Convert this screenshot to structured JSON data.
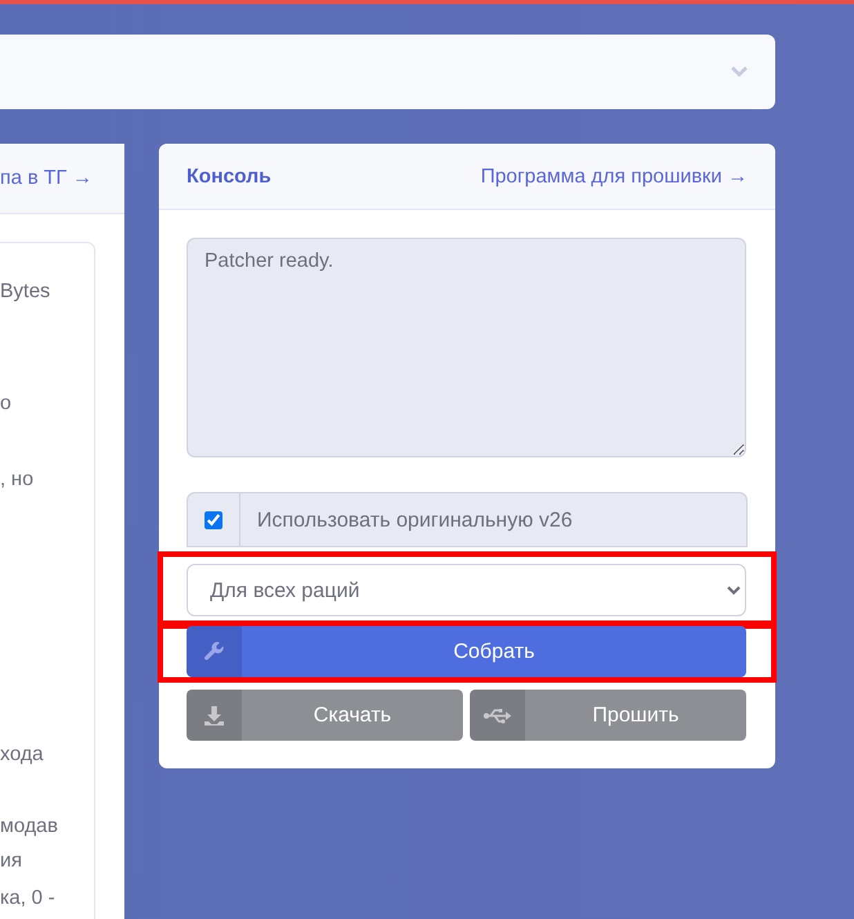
{
  "left_panel": {
    "header_link": "па в ТГ →",
    "lines": [
      "Bytes",
      "о",
      ", но",
      "хода",
      "модав",
      "ия",
      "ка, 0 -"
    ]
  },
  "console_panel": {
    "title": "Консоль",
    "header_link": "Программа для прошивки →",
    "log": "Patcher ready.",
    "use_original": {
      "label": "Использовать оригинальную v26",
      "checked": true
    },
    "radio_select": {
      "value": "Для всех раций",
      "highlighted": true
    },
    "buttons": [
      {
        "kind": "build",
        "label": "Собрать",
        "highlighted": true
      },
      {
        "kind": "download",
        "label": "Скачать",
        "highlighted": false
      },
      {
        "kind": "flash",
        "label": "Прошить",
        "highlighted": false
      }
    ]
  }
}
